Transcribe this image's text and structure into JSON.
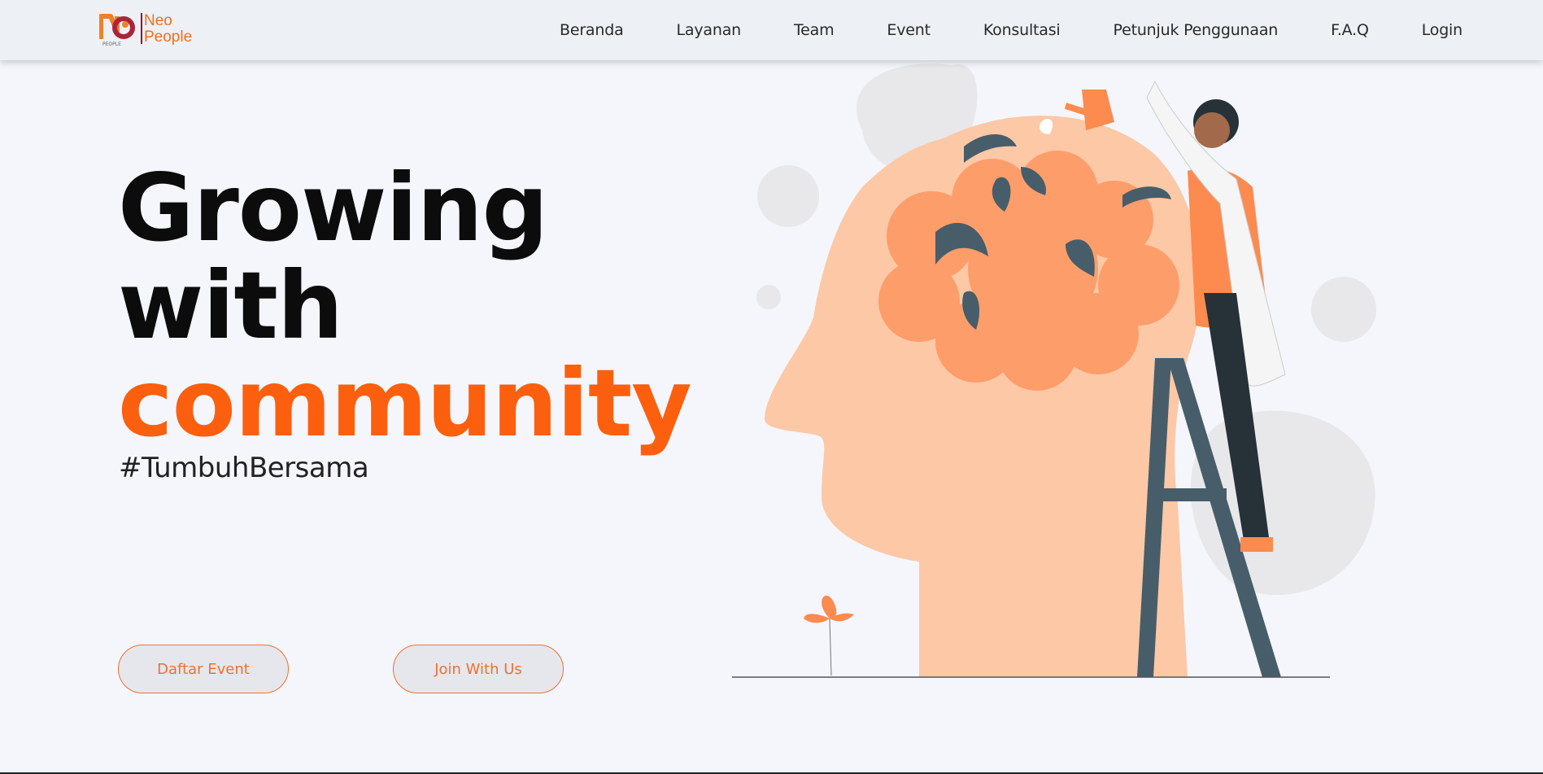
{
  "logo": {
    "line1": "Neo",
    "line2": "People",
    "mark_caption": "PEOPLE"
  },
  "nav": {
    "items": [
      {
        "label": "Beranda"
      },
      {
        "label": "Layanan"
      },
      {
        "label": "Team"
      },
      {
        "label": "Event"
      },
      {
        "label": "Konsultasi"
      },
      {
        "label": "Petunjuk Penggunaan"
      },
      {
        "label": "F.A.Q"
      },
      {
        "label": "Login"
      }
    ]
  },
  "hero": {
    "line1": "Growing",
    "line2": "with",
    "line3": "community",
    "hashtag": "#TumbuhBersama",
    "btn_daftar": "Daftar Event",
    "btn_join": "Join With Us"
  },
  "colors": {
    "accent": "#fc5f0e",
    "nav_bg": "#edf0f4",
    "page_bg": "#f4f6fc"
  }
}
